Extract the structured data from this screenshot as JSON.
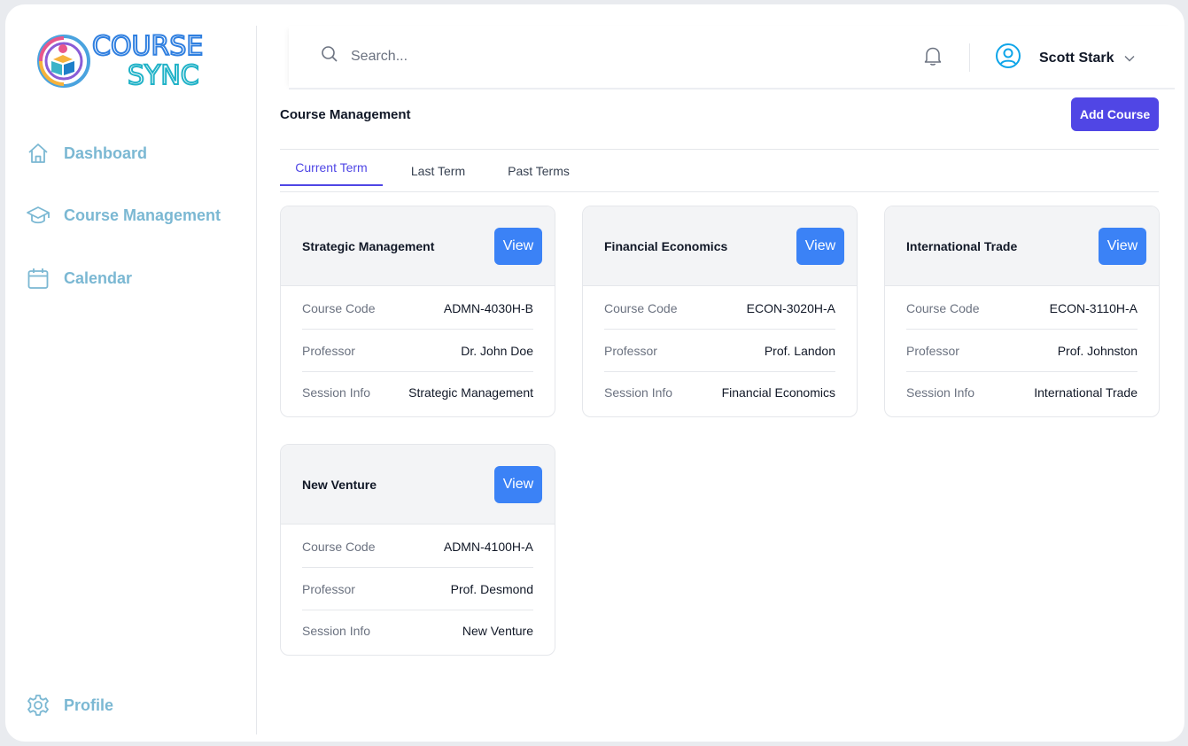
{
  "brand": {
    "line1": "COURSE",
    "line2": "SYNC"
  },
  "sidebar": {
    "items": [
      {
        "label": "Dashboard",
        "icon": "home-icon"
      },
      {
        "label": "Course Management",
        "icon": "graduation-cap-icon"
      },
      {
        "label": "Calendar",
        "icon": "calendar-icon"
      }
    ],
    "footer": {
      "label": "Profile",
      "icon": "gear-icon"
    }
  },
  "header": {
    "search_placeholder": "Search...",
    "user_name": "Scott Stark"
  },
  "main": {
    "title": "Course Management",
    "add_button": "Add Course",
    "tabs": [
      {
        "label": "Current Term",
        "active": true
      },
      {
        "label": "Last Term",
        "active": false
      },
      {
        "label": "Past Terms",
        "active": false
      }
    ],
    "field_labels": {
      "code": "Course Code",
      "professor": "Professor",
      "session": "Session Info"
    },
    "view_label": "View",
    "courses": [
      {
        "title": "Strategic Management",
        "code": "ADMN-4030H-B",
        "professor": "Dr. John Doe",
        "session": "Strategic Management"
      },
      {
        "title": "Financial Economics",
        "code": "ECON-3020H-A",
        "professor": "Prof. Landon",
        "session": "Financial Economics"
      },
      {
        "title": "International Trade",
        "code": "ECON-3110H-A",
        "professor": "Prof. Johnston",
        "session": "International Trade"
      },
      {
        "title": "New Venture",
        "code": "ADMN-4100H-A",
        "professor": "Prof. Desmond",
        "session": "New Venture"
      }
    ]
  },
  "colors": {
    "accent": "#5046e5",
    "view_button": "#3b82f6",
    "sidebar_text": "#7bb8d3",
    "tab_active": "#4f46e5"
  }
}
